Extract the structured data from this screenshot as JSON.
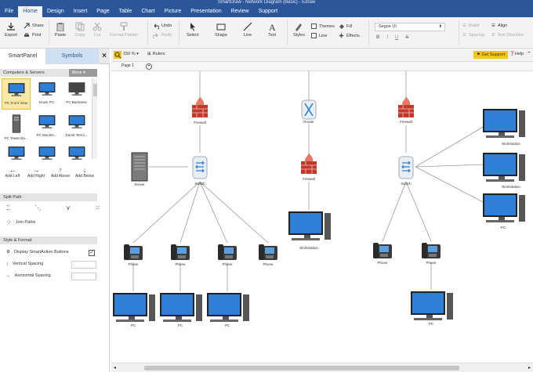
{
  "window": {
    "title": "SmartDraw - Network Diagram (Basic) - Edraw"
  },
  "menu": [
    "File",
    "Home",
    "Design",
    "Insert",
    "Page",
    "Table",
    "Chart",
    "Picture",
    "Presentation",
    "Review",
    "Support"
  ],
  "ribbon": {
    "export": "Export",
    "share": "Share",
    "print": "Print",
    "paste": "Paste",
    "copy": "Copy",
    "cut": "Cut",
    "format_painter": "Format Painter",
    "undo": "Undo",
    "redo": "Redo",
    "select": "Select",
    "shape": "Shape",
    "line": "Line",
    "text": "Text",
    "styles": "Styles",
    "themes": "Themes",
    "line_small": "Line",
    "fill": "Fill",
    "effects": "Effects",
    "font_name": "Segoe UI",
    "bold": "B",
    "italic": "I",
    "underline": "U",
    "strike": "S",
    "bullet": "Bullet",
    "align": "Align",
    "spacing": "Spacing",
    "text_direction": "Text Direction"
  },
  "panel": {
    "tab_smart": "SmartPanel",
    "tab_symbols": "Symbols",
    "close": "×",
    "section_computers": "Computers & Servers",
    "more": "More",
    "tiles": [
      "PC Front View",
      "Down PC",
      "PC Backview",
      "PC Tower Ba...",
      "PC Monitor...",
      "Dumb Termi...",
      "",
      "",
      ""
    ],
    "add_left": "Add Left",
    "add_right": "Add Right",
    "add_above": "Add Above",
    "add_below": "Add Below",
    "split_path": "Split Path",
    "join_paths": "Join Paths",
    "style_format": "Style & Format",
    "display_smart": "Display SmartAction Buttons",
    "vertical_spacing": "Vertical Spacing",
    "horizontal_spacing": "Horizontal Spacing"
  },
  "canvas": {
    "zoom": "150 %",
    "rulers": "Rulers",
    "get_support": "Get Support",
    "help": "Help",
    "page_tab": "Page 1"
  },
  "diagram": {
    "firewall": "Firewall",
    "router": "Router",
    "switch": "Switch",
    "server": "Server",
    "workstation": "Workstation",
    "phone": "Phone",
    "pc": "PC"
  },
  "colors": {
    "accent": "#2b579a",
    "firewall": "#c0392b",
    "selection": "#fde9a7"
  }
}
